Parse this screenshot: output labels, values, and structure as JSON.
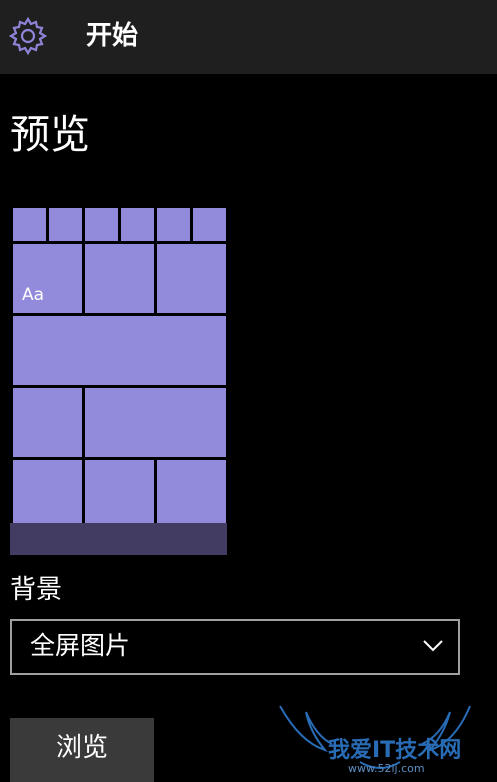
{
  "header": {
    "title": "开始",
    "settings_icon": "gear-icon"
  },
  "preview": {
    "heading": "预览",
    "sample_tile_text": "Aa",
    "accent_color": "#928ada",
    "taskbar_color": "#423c62"
  },
  "background": {
    "label": "背景",
    "dropdown_value": "全屏图片",
    "dropdown_icon": "chevron-down-icon"
  },
  "browse_button": {
    "label": "浏览"
  },
  "watermark": {
    "text": "我爱IT技术网",
    "sub": "www.52ij.com"
  }
}
